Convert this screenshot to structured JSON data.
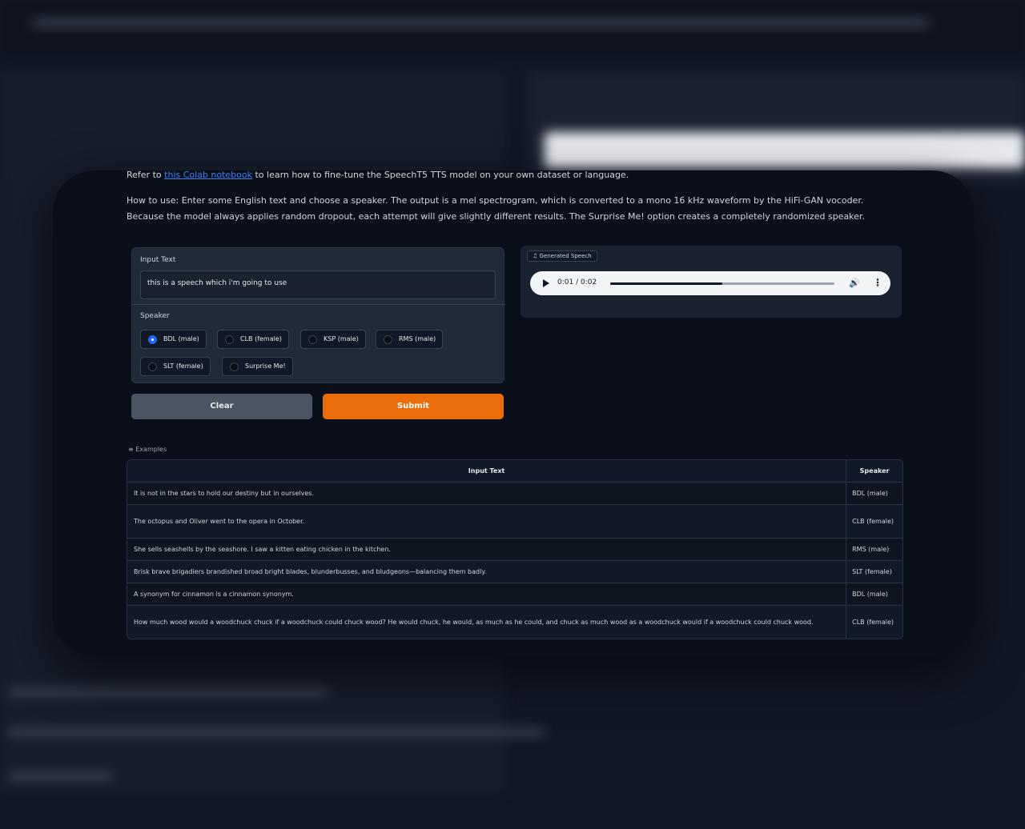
{
  "intro": {
    "line1_prefix": "Refer to ",
    "line1_link": "this Colab notebook",
    "line1_suffix": " to learn how to fine-tune the SpeechT5 TTS model on your own dataset or language.",
    "line2": "How to use: Enter some English text and choose a speaker. The output is a mel spectrogram, which is converted to a mono 16 kHz waveform by the HiFi-GAN vocoder. Because the model always applies random dropout, each attempt will give slightly different results. The Surprise Me! option creates a completely randomized speaker."
  },
  "input": {
    "label": "Input Text",
    "value": "this is a speech which i'm going to use"
  },
  "speaker": {
    "label": "Speaker",
    "options": [
      "BDL (male)",
      "CLB (female)",
      "KSP (male)",
      "RMS (male)",
      "SLT (female)",
      "Surprise Me!"
    ],
    "selected": "BDL (male)"
  },
  "buttons": {
    "clear": "Clear",
    "submit": "Submit"
  },
  "output": {
    "label": "Generated Speech",
    "time": "0:01 / 0:02",
    "progress": 0.5
  },
  "examples": {
    "label": "Examples",
    "headers": [
      "Input Text",
      "Speaker"
    ],
    "rows": [
      [
        "It is not in the stars to hold our destiny but in ourselves.",
        "BDL (male)"
      ],
      [
        "The octopus and Oliver went to the opera in October.",
        "CLB (female)"
      ],
      [
        "She sells seashells by the seashore. I saw a kitten eating chicken in the kitchen.",
        "RMS (male)"
      ],
      [
        "Brisk brave brigadiers brandished broad bright blades, blunderbusses, and bludgeons—balancing them badly.",
        "SLT (female)"
      ],
      [
        "A synonym for cinnamon is a cinnamon synonym.",
        "BDL (male)"
      ],
      [
        "How much wood would a woodchuck chuck if a woodchuck could chuck wood? He would chuck, he would, as much as he could, and chuck as much wood as a woodchuck would if a woodchuck could chuck wood.",
        "CLB (female)"
      ]
    ]
  }
}
